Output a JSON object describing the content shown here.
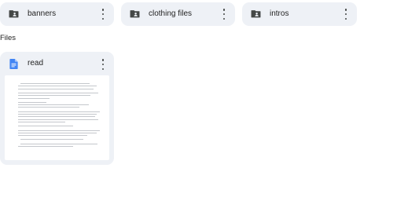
{
  "folders": [
    {
      "label": "banners",
      "icon": "shared-folder-icon"
    },
    {
      "label": "clothing files",
      "icon": "shared-folder-icon"
    },
    {
      "label": "intros",
      "icon": "shared-folder-icon"
    }
  ],
  "files_section": {
    "label": "Files"
  },
  "files": [
    {
      "label": "read",
      "icon": "google-docs-icon"
    }
  ],
  "colors": {
    "card_bg": "#eef1f6",
    "docs_blue": "#4285f4",
    "folder_icon": "#444746",
    "text": "#1f1f1f"
  }
}
